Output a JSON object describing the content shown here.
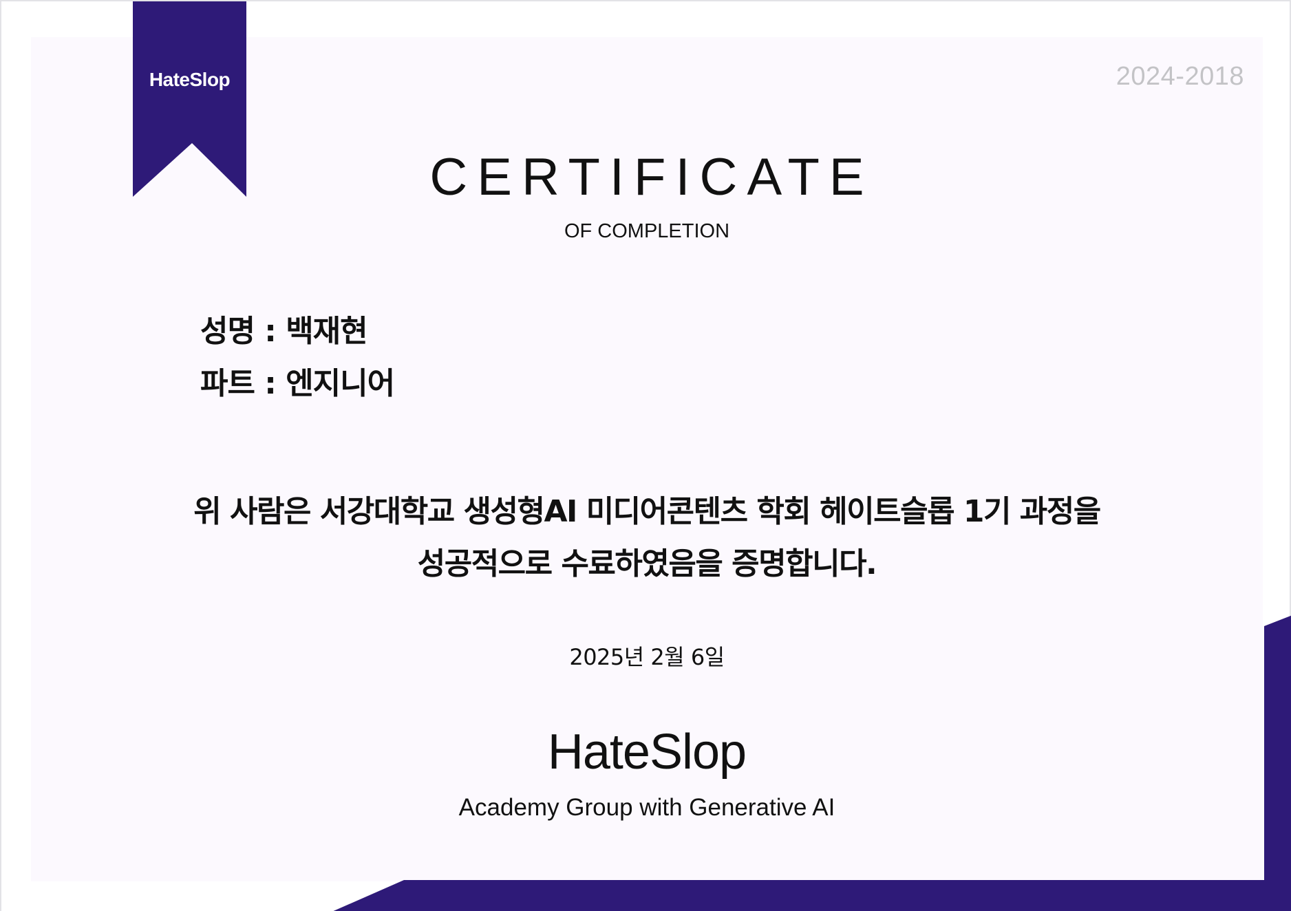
{
  "colors": {
    "accent": "#2e1a78",
    "panel_background": "#fcf9fe",
    "year_text": "#c3c3c6",
    "text": "#111111"
  },
  "ribbon": {
    "label": "HateSlop"
  },
  "year_range": "2024-2018",
  "certificate": {
    "title": "CERTIFICATE",
    "subtitle": "OF COMPLETION"
  },
  "recipient": {
    "name_line": "성명 : 백재현",
    "part_line": "파트 : 엔지니어"
  },
  "statement": {
    "line1": "위 사람은 서강대학교 생성형AI 미디어콘텐츠 학회 헤이트슬롭 1기 과정을",
    "line2": "성공적으로 수료하였음을 증명합니다."
  },
  "issue_date": "2025년 2월 6일",
  "footer": {
    "brand": "HateSlop",
    "tagline": "Academy Group with Generative AI"
  }
}
